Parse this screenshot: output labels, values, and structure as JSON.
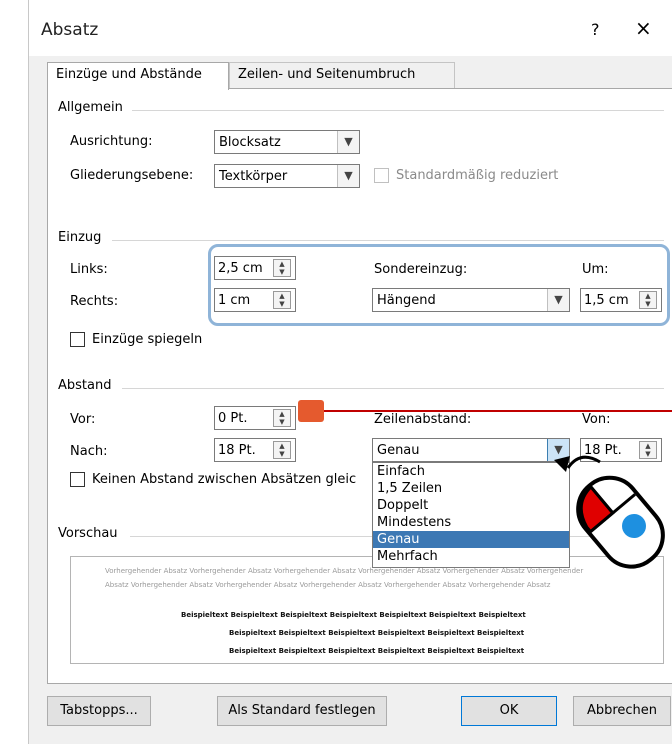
{
  "window": {
    "title": "Absatz",
    "help_label": "?",
    "close_label": "×"
  },
  "tabs": [
    {
      "label": "Einzüge und Abstände"
    },
    {
      "label": "Zeilen- und Seitenumbruch"
    }
  ],
  "general": {
    "group_label": "Allgemein",
    "alignment_label": "Ausrichtung:",
    "alignment_value": "Blocksatz",
    "outline_label": "Gliederungsebene:",
    "outline_value": "Textkörper",
    "collapsed_label": "Standardmäßig reduziert"
  },
  "indent": {
    "group_label": "Einzug",
    "left_label": "Links:",
    "left_value": "2,5 cm",
    "right_label": "Rechts:",
    "right_value": "1 cm",
    "special_label": "Sondereinzug:",
    "special_value": "Hängend",
    "by_label": "Um:",
    "by_value": "1,5 cm",
    "mirror_label": "Einzüge spiegeln"
  },
  "spacing": {
    "group_label": "Abstand",
    "before_label": "Vor:",
    "before_value": "0 Pt.",
    "after_label": "Nach:",
    "after_value": "18 Pt.",
    "line_spacing_label": "Zeilenabstand:",
    "line_spacing_value": "Genau",
    "at_label": "Von:",
    "at_value": "18 Pt.",
    "no_space_label": "Keinen Abstand zwischen Absätzen gleic"
  },
  "line_spacing_options": [
    "Einfach",
    "1,5 Zeilen",
    "Doppelt",
    "Mindestens",
    "Genau",
    "Mehrfach"
  ],
  "line_spacing_selected_index": 4,
  "preview": {
    "group_label": "Vorschau",
    "prev_line1": "Vorhergehender Absatz Vorhergehender Absatz Vorhergehender Absatz Vorhergehender Absatz Vorhergehender Absatz Vorhergehender",
    "prev_line2": "Absatz Vorhergehender Absatz Vorhergehender Absatz Vorhergehender Absatz Vorhergehender Absatz Vorhergehender Absatz",
    "sample_line1": "Beispieltext Beispieltext Beispieltext Beispieltext Beispieltext Beispieltext Beispieltext",
    "sample_line2": "Beispieltext Beispieltext Beispieltext Beispieltext Beispieltext Beispieltext",
    "sample_line3": "Beispieltext Beispieltext Beispieltext Beispieltext Beispieltext Beispieltext"
  },
  "buttons": {
    "tabs_label": "Tabstopps...",
    "default_label": "Als Standard festlegen",
    "ok_label": "OK",
    "cancel_label": "Abbrechen"
  },
  "colors": {
    "highlight_border": "#8fb4d8",
    "selected_item": "#3c78b4",
    "callout": "#e55a2e",
    "mouse_button": "#e00000",
    "mouse_dot": "#1e90e0"
  }
}
